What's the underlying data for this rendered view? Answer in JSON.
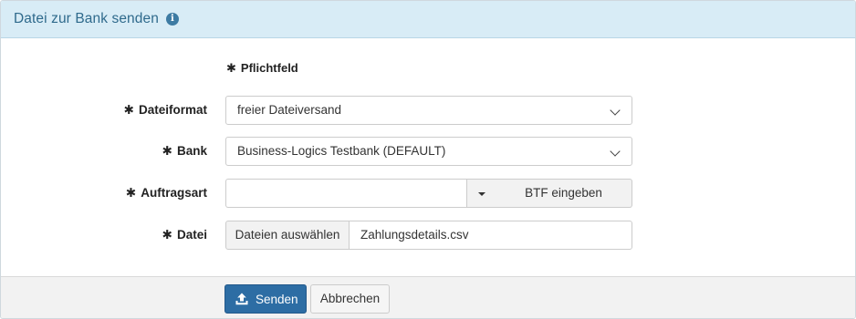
{
  "header": {
    "title": "Datei zur Bank senden",
    "info_icon": "info-icon",
    "info_glyph": "i"
  },
  "form": {
    "required_star": "✱",
    "required_note": "Pflichtfeld",
    "fields": {
      "dateiformat": {
        "label": "Dateiformat",
        "value": "freier Dateiversand",
        "icon": "chevron-down-icon"
      },
      "bank": {
        "label": "Bank",
        "value": "Business-Logics Testbank (DEFAULT)",
        "icon": "chevron-down-icon"
      },
      "auftragsart": {
        "label": "Auftragsart",
        "value": "",
        "caret_icon": "caret-down-icon",
        "button_label": "BTF eingeben"
      },
      "datei": {
        "label": "Datei",
        "choose_label": "Dateien auswählen",
        "file_name": "Zahlungsdetails.csv"
      }
    }
  },
  "footer": {
    "send_label": "Senden",
    "send_icon": "upload-icon",
    "cancel_label": "Abbrechen"
  },
  "colors": {
    "header_bg": "#d8ecf6",
    "title": "#2f6a8c",
    "primary_button": "#2d6da4",
    "footer_bg": "#f2f2f2"
  }
}
